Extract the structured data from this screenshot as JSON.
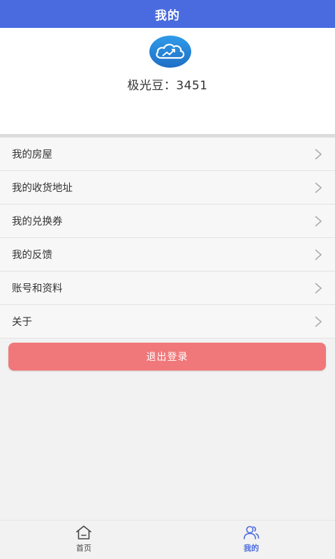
{
  "header": {
    "title": "我的"
  },
  "profile": {
    "points_text": "极光豆：3451"
  },
  "menu": {
    "items": [
      {
        "label": "我的房屋"
      },
      {
        "label": "我的收货地址"
      },
      {
        "label": "我的兑换券"
      },
      {
        "label": "我的反馈"
      },
      {
        "label": "账号和资料"
      },
      {
        "label": "关于"
      }
    ]
  },
  "logout": {
    "label": "退出登录"
  },
  "tabbar": {
    "tabs": [
      {
        "label": "首页",
        "icon": "home-icon",
        "active": false
      },
      {
        "label": "我的",
        "icon": "users-icon",
        "active": true
      }
    ]
  },
  "colors": {
    "header_bg": "#4a6be0",
    "logout_bg": "#f0787a",
    "active_tab": "#4a6be0"
  }
}
